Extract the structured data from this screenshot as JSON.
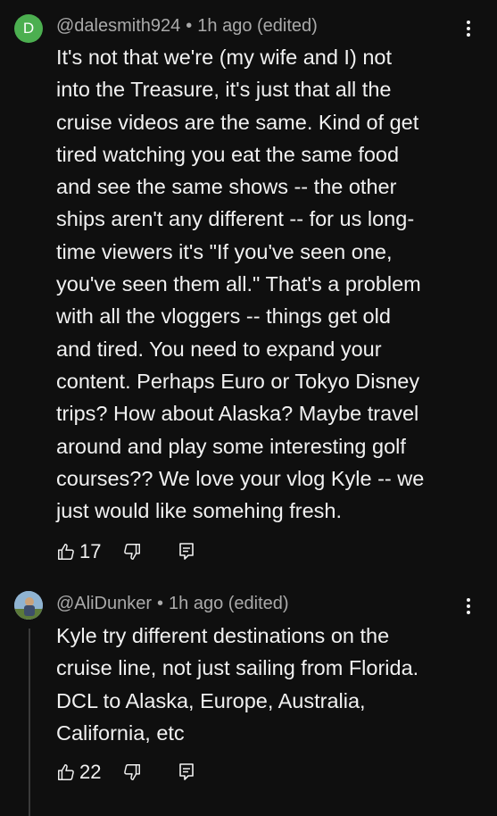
{
  "comments": [
    {
      "avatar_letter": "D",
      "avatar_color": "#4caf50",
      "username": "@dalesmith924",
      "separator": "•",
      "time": "1h ago (edited)",
      "text": "It's not that we're (my wife and I) not\ninto the Treasure, it's just that all the\ncruise videos are the same. Kind of get\ntired watching you eat the same food\nand see the same shows -- the other\nships aren't any different -- for us long-\ntime viewers it's \"If you've seen one,\nyou've seen them all.\"  That's a problem\nwith all the vloggers -- things get old\nand tired. You need to expand your\ncontent. Perhaps Euro or Tokyo Disney\ntrips? How about Alaska? Maybe travel\naround and play some interesting golf\ncourses?? We love your vlog Kyle -- we\njust would like somehing fresh.",
      "likes": "17",
      "icons": [
        "thumbs-up-icon",
        "thumbs-down-icon",
        "reply-icon",
        "more-vertical-icon"
      ]
    },
    {
      "username": "@AliDunker",
      "separator": "•",
      "time": "1h ago (edited)",
      "text": "Kyle try different destinations on the\ncruise line, not just sailing from Florida.\nDCL to Alaska, Europe, Australia,\nCalifornia, etc",
      "likes": "22",
      "icons": [
        "thumbs-up-icon",
        "thumbs-down-icon",
        "reply-icon",
        "more-vertical-icon"
      ]
    }
  ],
  "colors": {
    "background": "#0f0f0f",
    "text": "#f1f1f1",
    "secondary_text": "#aaaaaa"
  }
}
